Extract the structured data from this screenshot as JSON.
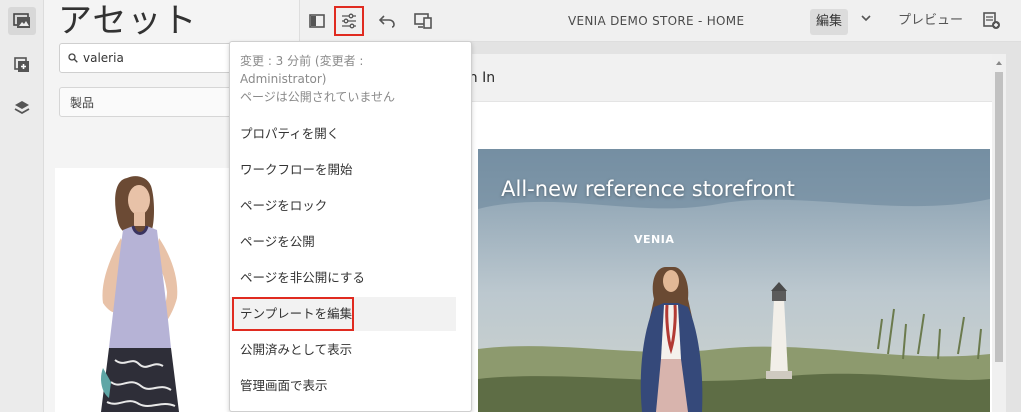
{
  "panel": {
    "title": "アセット",
    "search_value": "valeria",
    "filter_value": "製品"
  },
  "toolbar": {
    "page_title": "VENIA DEMO STORE - HOME",
    "edit_label": "編集",
    "preview_label": "プレビュー"
  },
  "page": {
    "nav_link": "ign In",
    "hero_title": "All-new reference storefront",
    "hero_brand": "VENIA"
  },
  "menu": {
    "info_line1": "変更 : 3 分前 (変更者 :",
    "info_line2": "Administrator)",
    "info_line3": "ページは公開されていません",
    "items": [
      {
        "label": "プロパティを開く"
      },
      {
        "label": "ワークフローを開始"
      },
      {
        "label": "ページをロック"
      },
      {
        "label": "ページを公開"
      },
      {
        "label": "ページを非公開にする"
      },
      {
        "label": "テンプレートを編集"
      },
      {
        "label": "公開済みとして表示"
      },
      {
        "label": "管理画面で表示"
      }
    ]
  },
  "colors": {
    "highlight": "#e02b20",
    "toolbar_bg": "#f0f0f0"
  },
  "icons": {
    "rail": [
      "asset-finder-icon",
      "components-icon",
      "layers-icon"
    ],
    "toolbar": [
      "side-panel-toggle-icon",
      "page-properties-icon",
      "undo-icon",
      "emulator-icon",
      "publish-page-icon"
    ]
  }
}
